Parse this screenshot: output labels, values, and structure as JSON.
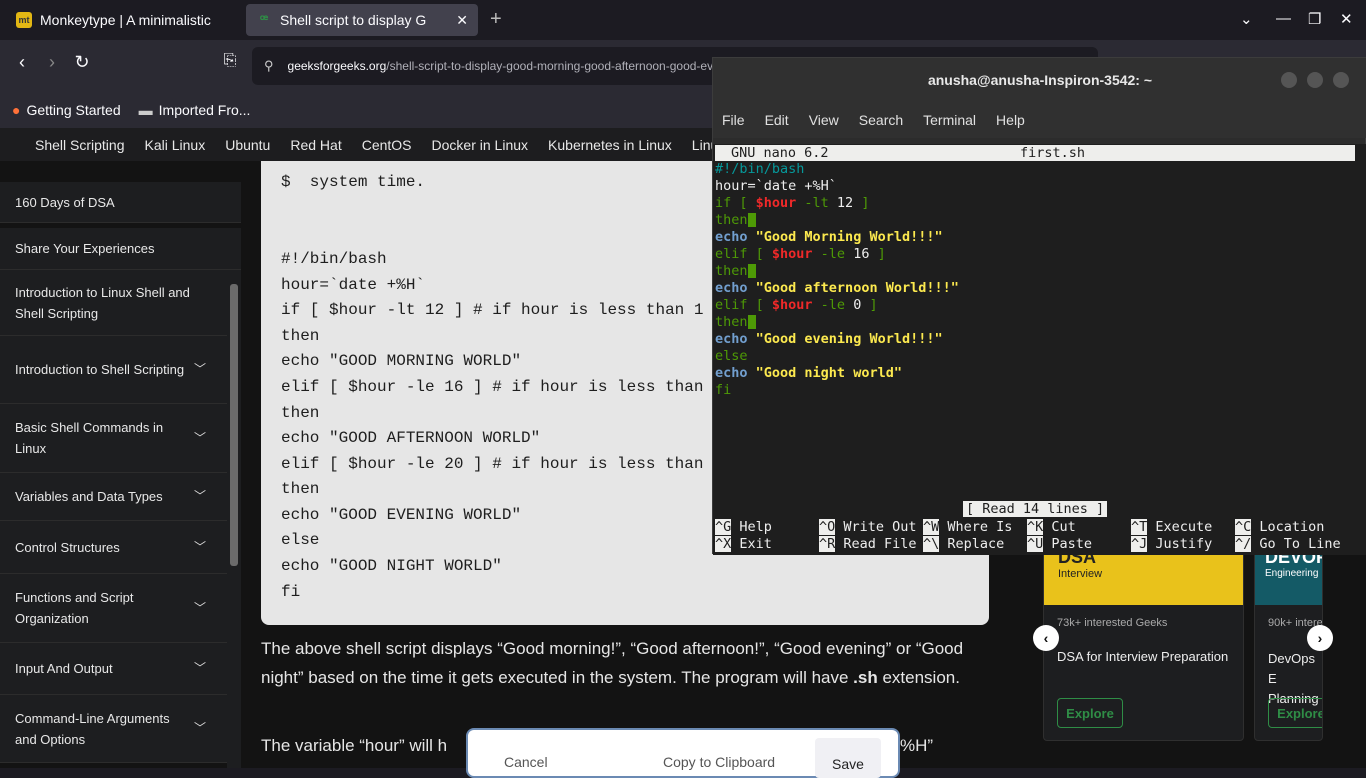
{
  "tabs": [
    {
      "title": "Monkeytype | A minimalistic",
      "icon": "monkeytype-icon"
    },
    {
      "title": "Shell script to display G",
      "icon": "gfg-icon"
    }
  ],
  "url": {
    "domain": "geeksforgeeks.org",
    "path": "/shell-script-to-display-good-morning-good-afternoon-good-evening"
  },
  "bookmarks": [
    "Getting Started",
    "Imported Fro..."
  ],
  "gfg_nav": [
    "Shell Scripting",
    "Kali Linux",
    "Ubuntu",
    "Red Hat",
    "CentOS",
    "Docker in Linux",
    "Kubernetes in Linux",
    "Linux"
  ],
  "sidebar": [
    {
      "label": "160 Days of DSA",
      "expand": false
    },
    {
      "label": "Share Your Experiences",
      "expand": false
    },
    {
      "label": "Introduction to Linux Shell and Shell Scripting",
      "expand": false
    },
    {
      "label": "Introduction to Shell Scripting",
      "expand": true
    },
    {
      "label": "Basic Shell Commands in Linux",
      "expand": true
    },
    {
      "label": "Variables and Data Types",
      "expand": true
    },
    {
      "label": "Control Structures",
      "expand": true
    },
    {
      "label": "Functions and Script Organization",
      "expand": true
    },
    {
      "label": "Input And Output",
      "expand": true
    },
    {
      "label": "Command-Line Arguments and Options",
      "expand": true
    }
  ],
  "code_lines": [
    "$  system time.",
    "",
    "",
    "#!/bin/bash",
    "hour=`date +%H`",
    "if [ $hour -lt 12 ] # if hour is less than 1",
    "then",
    "echo \"GOOD MORNING WORLD\"",
    "elif [ $hour -le 16 ] # if hour is less than",
    "then",
    "echo \"GOOD AFTERNOON WORLD\"",
    "elif [ $hour -le 20 ] # if hour is less than",
    "then",
    "echo \"GOOD EVENING WORLD\"",
    "else",
    "echo \"GOOD NIGHT WORLD\"",
    "fi"
  ],
  "para1_pre": "The above shell script displays “Good morning!”, “Good afternoon!”, “Good evening” or “Good night” based on the time it gets executed in the system. The program will have ",
  "para1_bold": ".sh",
  "para1_post": " extension.",
  "para2_left": "The variable “hour” will h",
  "para2_right": "%H”",
  "cards": [
    {
      "banner_title": "DSA",
      "banner_sub": "Interview",
      "interest": "73k+ interested Geeks",
      "title": "DSA for Interview Preparation",
      "button": "Explore"
    },
    {
      "banner_title": "DEVOP",
      "banner_sub": "Engineering",
      "interest": "90k+ intere",
      "title": "DevOps E Planning",
      "button": "Explore"
    }
  ],
  "dialog": {
    "cancel": "Cancel",
    "copy": "Copy to Clipboard",
    "save": "Save"
  },
  "terminal": {
    "title": "anusha@anusha-Inspiron-3542: ~",
    "menu": [
      "File",
      "Edit",
      "View",
      "Search",
      "Terminal",
      "Help"
    ],
    "nano_version": "GNU nano 6.2",
    "filename": "first.sh",
    "status": "[ Read 14 lines ]",
    "shortcuts_row1": [
      {
        "k": "^G",
        "l": "Help"
      },
      {
        "k": "^O",
        "l": "Write Out"
      },
      {
        "k": "^W",
        "l": "Where Is"
      },
      {
        "k": "^K",
        "l": "Cut"
      },
      {
        "k": "^T",
        "l": "Execute"
      },
      {
        "k": "^C",
        "l": "Location"
      }
    ],
    "shortcuts_row2": [
      {
        "k": "^X",
        "l": "Exit"
      },
      {
        "k": "^R",
        "l": "Read File"
      },
      {
        "k": "^\\",
        "l": "Replace"
      },
      {
        "k": "^U",
        "l": "Paste"
      },
      {
        "k": "^J",
        "l": "Justify"
      },
      {
        "k": "^/",
        "l": "Go To Line"
      }
    ]
  },
  "colors": {
    "gfg_green": "#2f8d46",
    "nano_keyword": "#4e9a06",
    "nano_var": "#ef2929",
    "nano_echo": "#729fcf",
    "nano_string": "#fce94f"
  }
}
